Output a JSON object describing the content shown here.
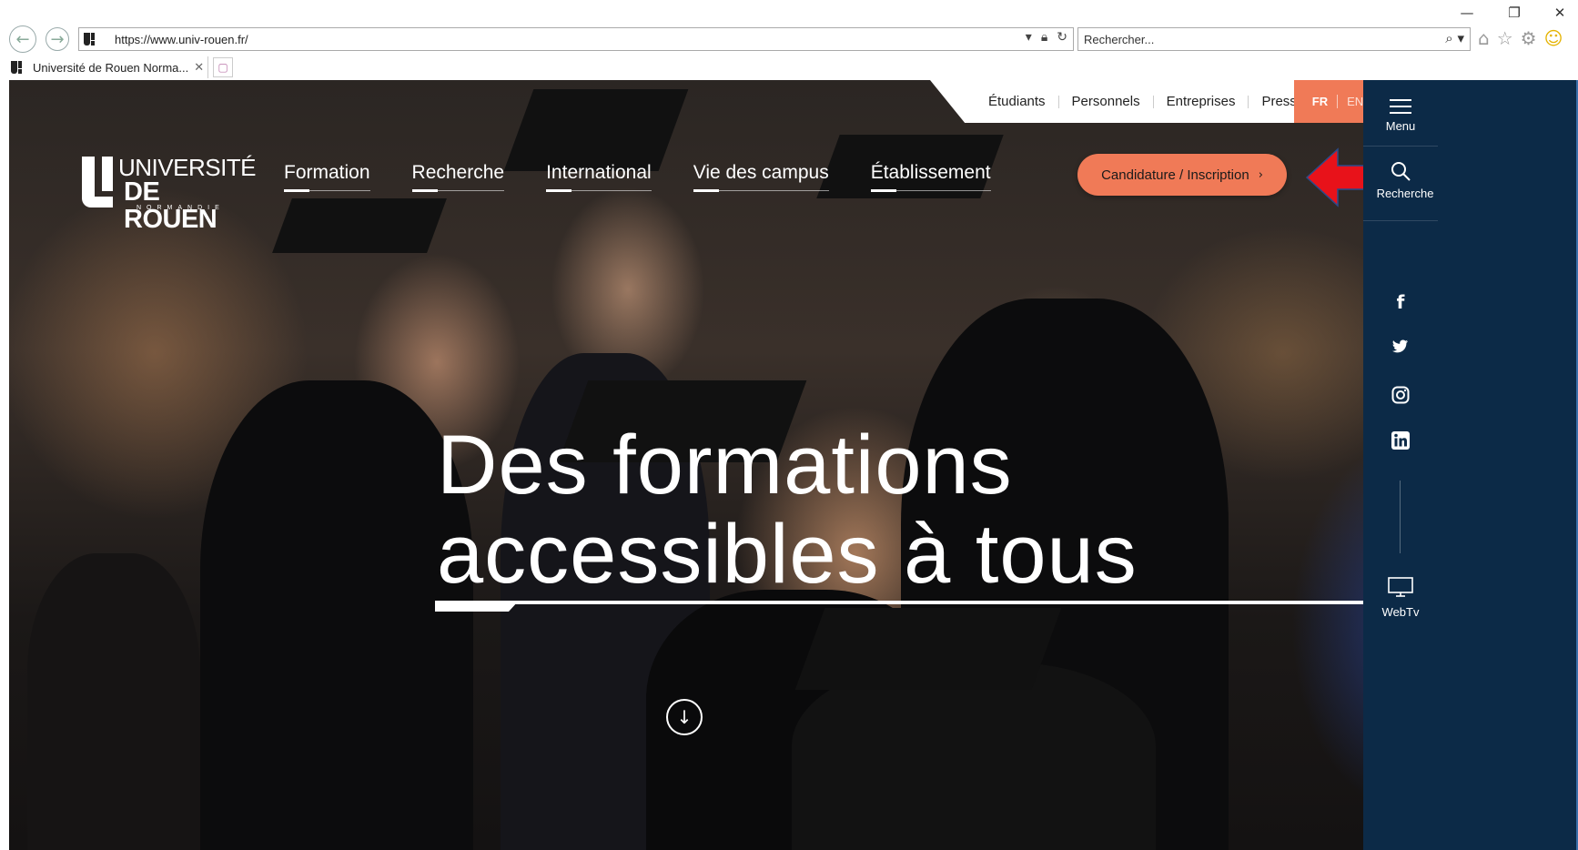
{
  "browser": {
    "url": "https://www.univ-rouen.fr/",
    "search_placeholder": "Rechercher...",
    "tab_title": "Université de Rouen Norma...",
    "window_controls": {
      "minimize": "—",
      "restore": "❐",
      "close": "✕"
    }
  },
  "site": {
    "utility_links": [
      "Étudiants",
      "Personnels",
      "Entreprises",
      "Presse"
    ],
    "lang": {
      "fr": "FR",
      "en": "EN"
    },
    "logo": {
      "line1": "UNIVERSITÉ",
      "line2": "DE ROUEN",
      "line3": "NORMANDIE"
    },
    "main_nav": [
      "Formation",
      "Recherche",
      "International",
      "Vie des campus",
      "Établissement"
    ],
    "cta_label": "Candidature / Inscription",
    "headline": {
      "line1": "Des formations",
      "line2": "accessibles à tous"
    },
    "sidebar": {
      "menu_label": "Menu",
      "search_label": "Recherche",
      "webtv_label": "WebTv"
    },
    "social_icons": [
      "facebook-icon",
      "twitter-icon",
      "instagram-icon",
      "linkedin-icon"
    ]
  },
  "colors": {
    "accent": "#f07a57",
    "sidebar": "#0c2a47",
    "annotation_arrow": "#e8121a"
  }
}
